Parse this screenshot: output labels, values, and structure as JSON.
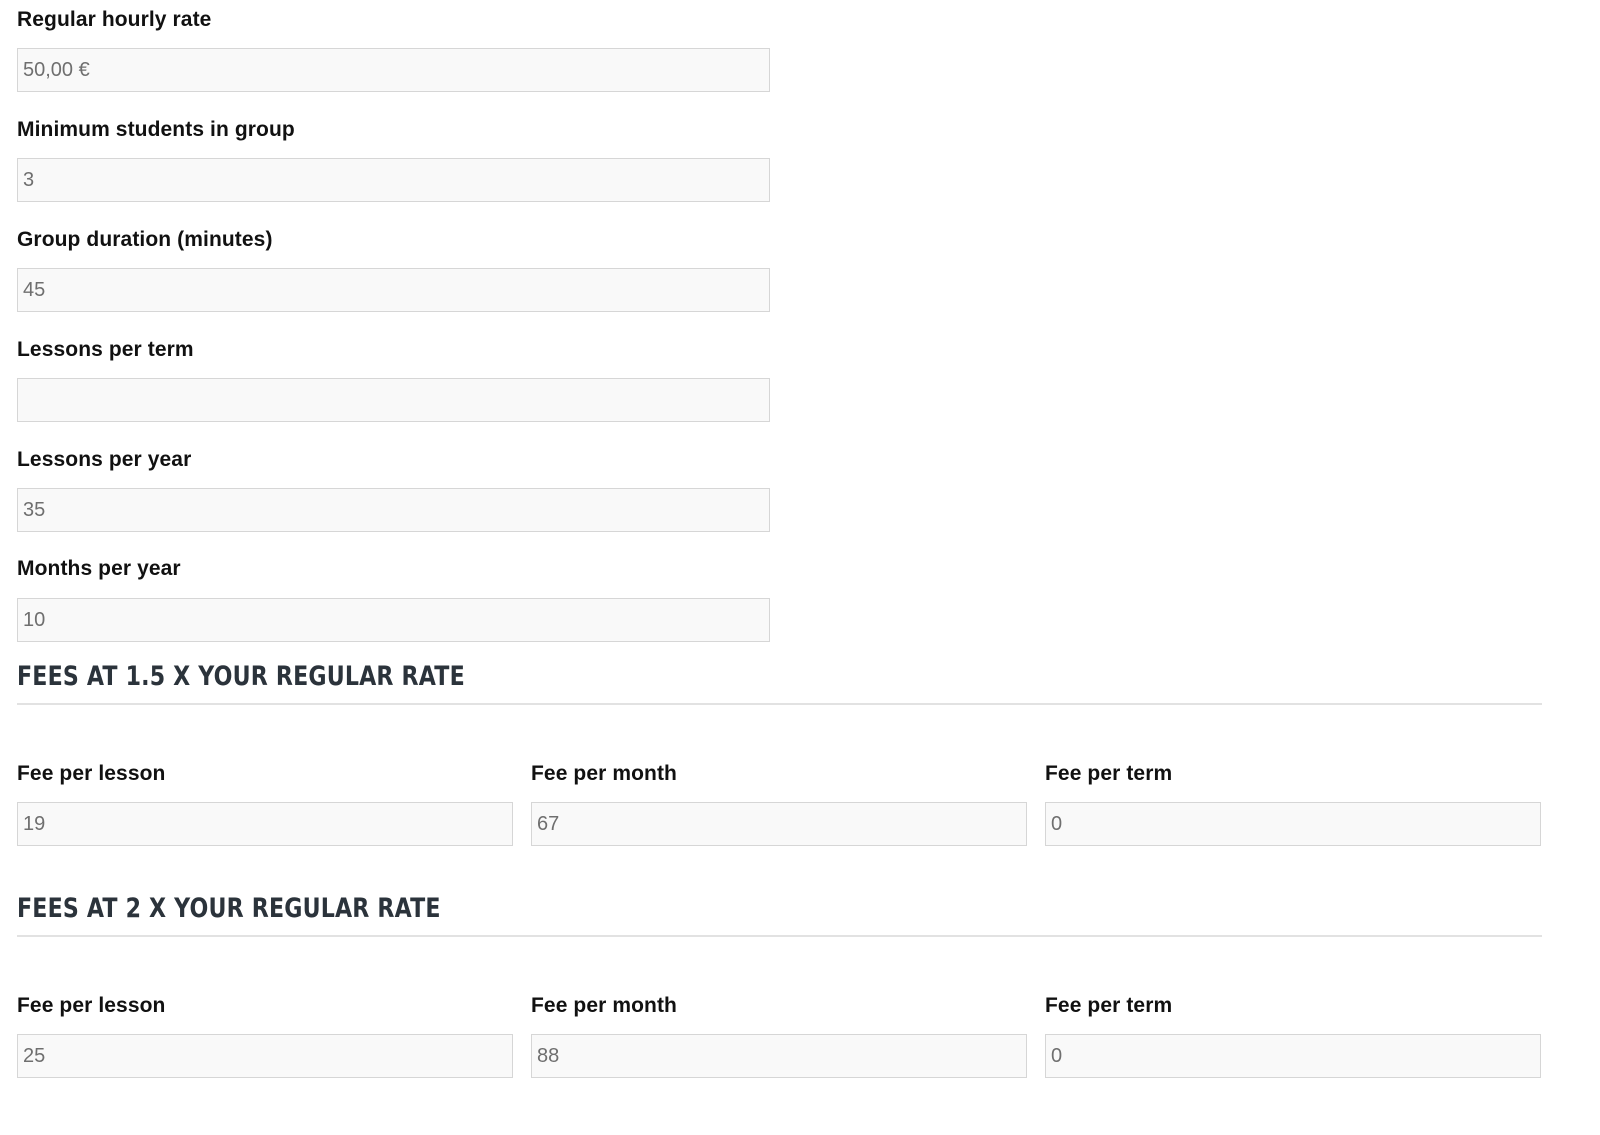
{
  "fields": {
    "regular_rate": {
      "label": "Regular hourly rate",
      "value": "50,00 €"
    },
    "min_students": {
      "label": "Minimum students in group",
      "value": "3"
    },
    "group_duration": {
      "label": "Group duration (minutes)",
      "value": "45"
    },
    "lessons_per_term": {
      "label": "Lessons per term",
      "value": ""
    },
    "lessons_per_year": {
      "label": "Lessons per year",
      "value": "35"
    },
    "months_per_year": {
      "label": "Months per year",
      "value": "10"
    }
  },
  "sections": [
    {
      "title": "FEES AT 1.5 X YOUR REGULAR RATE",
      "fee_per_lesson_label": "Fee per lesson",
      "fee_per_lesson": "19",
      "fee_per_month_label": "Fee per month",
      "fee_per_month": "67",
      "fee_per_term_label": "Fee per term",
      "fee_per_term": "0"
    },
    {
      "title": "FEES AT 2 X YOUR REGULAR RATE",
      "fee_per_lesson_label": "Fee per lesson",
      "fee_per_lesson": "25",
      "fee_per_month_label": "Fee per month",
      "fee_per_month": "88",
      "fee_per_term_label": "Fee per term",
      "fee_per_term": "0"
    }
  ]
}
